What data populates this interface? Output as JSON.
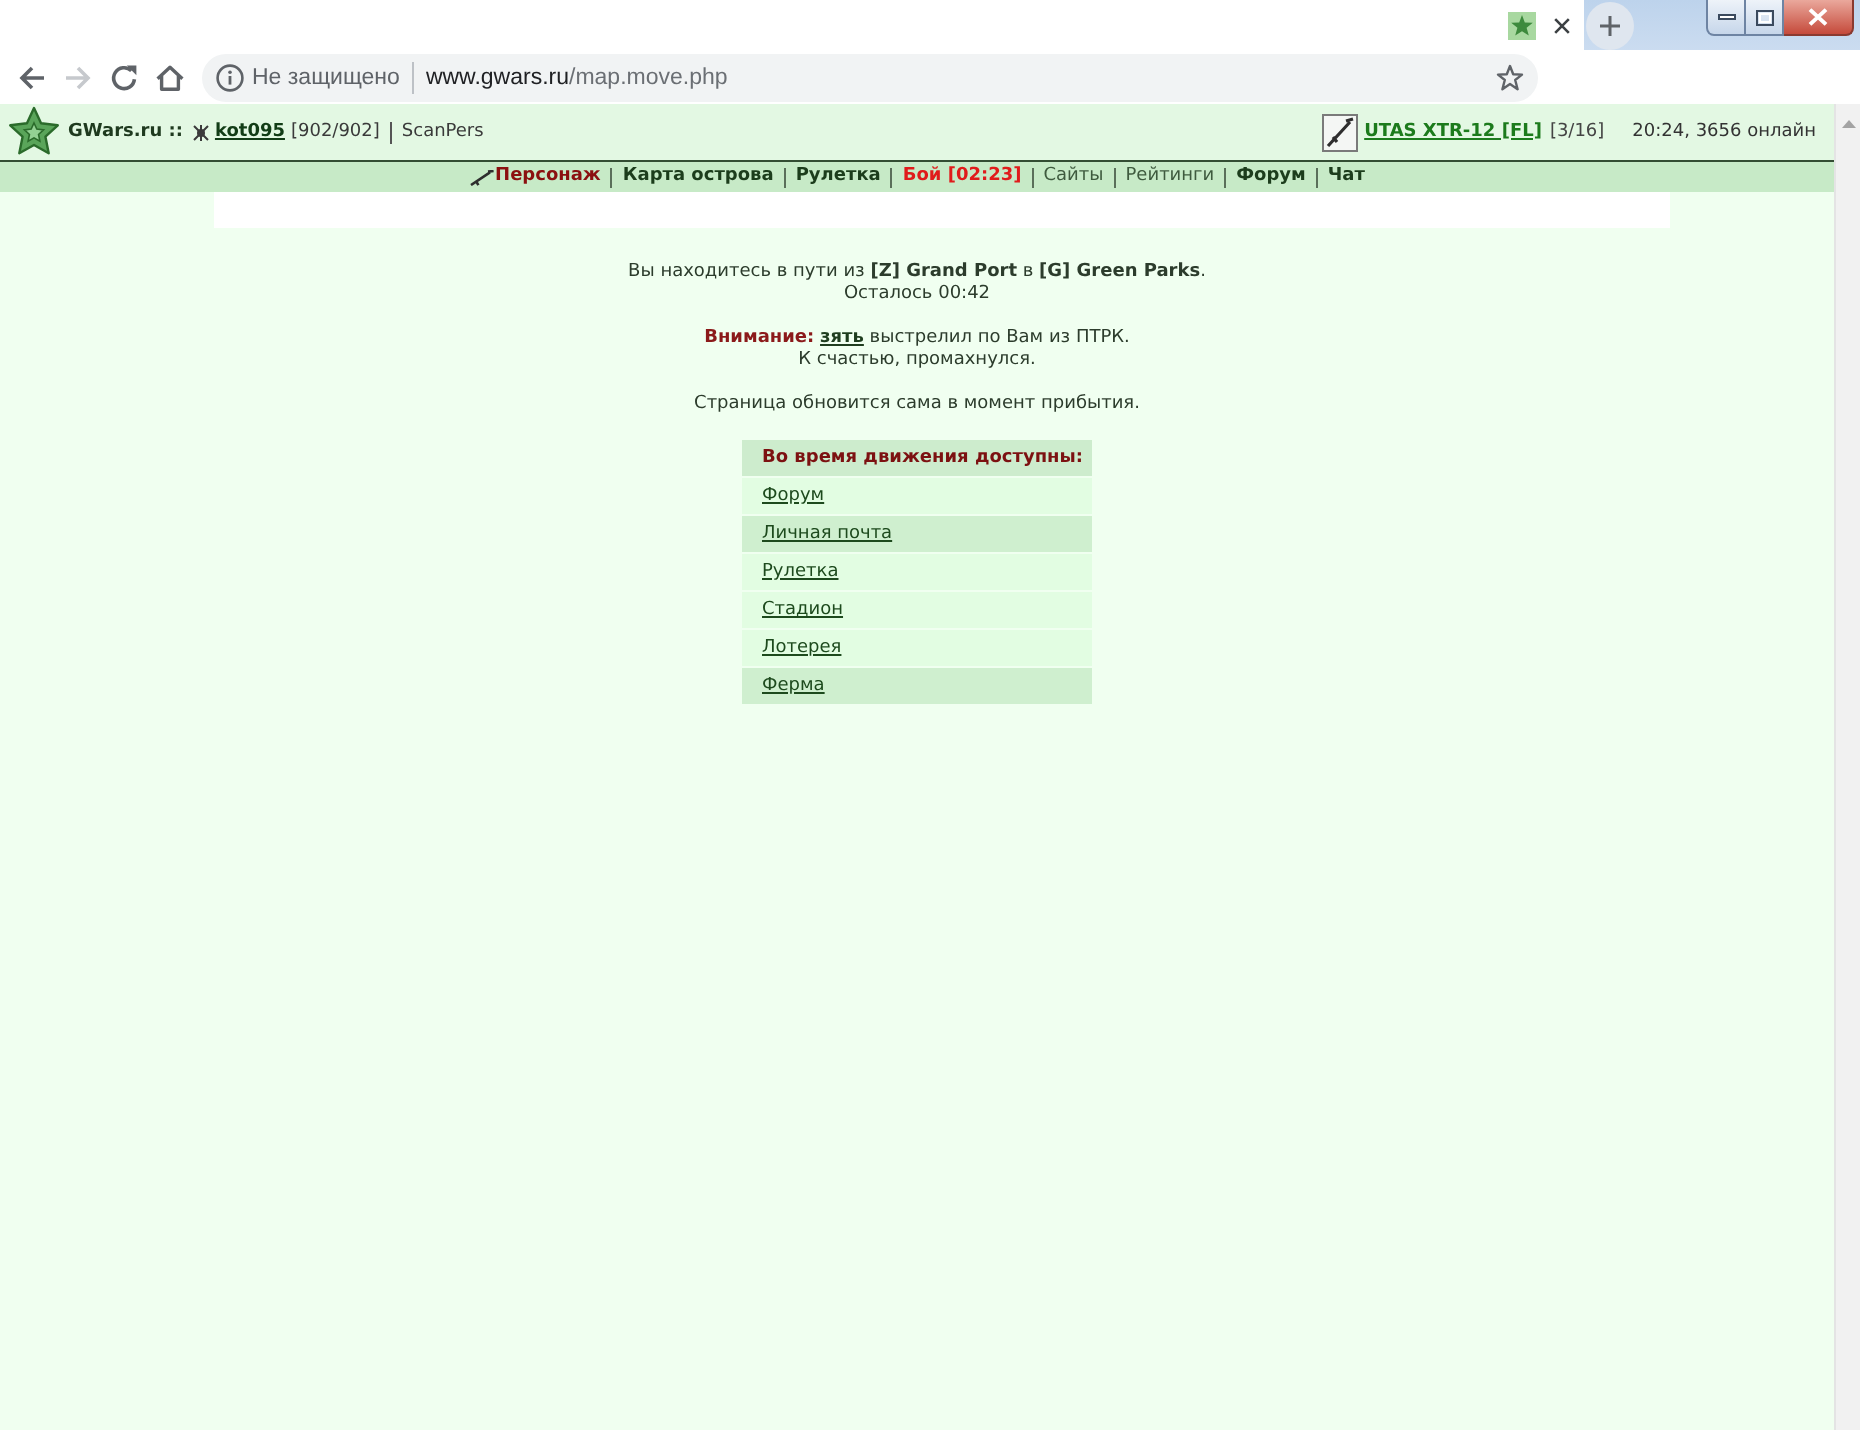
{
  "browser": {
    "nav_buttons": [
      {
        "kind": "back",
        "disabled": false
      },
      {
        "kind": "forward",
        "disabled": true
      },
      {
        "kind": "reload",
        "disabled": false
      },
      {
        "kind": "home",
        "disabled": false
      }
    ],
    "security_label": "Не защищено",
    "url_host": "www.gwars.ru",
    "url_path": "/map.move.php"
  },
  "header": {
    "site": "GWars.ru ::",
    "user": "kot095",
    "health": "[902/902]",
    "link": "ScanPers",
    "weapon": "UTAS XTR-12 [FL]",
    "ammo": "[3/16]",
    "status": "20:24, 3656 онлайн"
  },
  "nav": [
    {
      "label": "Персонаж",
      "kind": "current"
    },
    {
      "label": "Карта острова",
      "kind": "bold"
    },
    {
      "label": "Рулетка",
      "kind": "bold"
    },
    {
      "label": "Бой [02:23]",
      "kind": "alert"
    },
    {
      "label": "Сайты",
      "kind": "plain"
    },
    {
      "label": "Рейтинги",
      "kind": "plain"
    },
    {
      "label": "Форум",
      "kind": "bold"
    },
    {
      "label": "Чат",
      "kind": "bold"
    }
  ],
  "travel": {
    "text": "Вы находитесь в пути из **[Z] Grand Port** в **[G] Green Parks**.",
    "remaining": "Осталось 00:42"
  },
  "warning": {
    "label": "Внимание:",
    "attacker": "зять",
    "text": "выстрелил по Вам из ПТРК.",
    "note": "К счастью, промахнулся."
  },
  "refresh_note": "Страница обновится сама в момент прибытия.",
  "actions": {
    "title": "Во время движения доступны:",
    "items": [
      {
        "label": "Форум",
        "highlighted": false
      },
      {
        "label": "Личная почта",
        "highlighted": true
      },
      {
        "label": "Рулетка",
        "highlighted": false
      },
      {
        "label": "Стадион",
        "highlighted": false
      },
      {
        "label": "Лотерея",
        "highlighted": false
      },
      {
        "label": "Ферма",
        "highlighted": true
      }
    ]
  }
}
